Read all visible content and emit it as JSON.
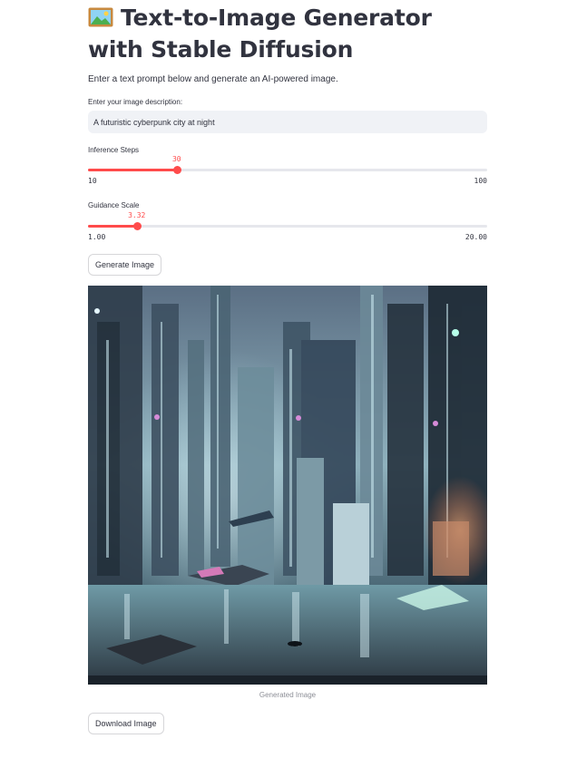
{
  "app": {
    "title_icon": "framed-picture-icon",
    "title": "Text-to-Image Generator with Stable Diffusion",
    "description": "Enter a text prompt below and generate an AI-powered image."
  },
  "prompt": {
    "label": "Enter your image description:",
    "value": "A futuristic cyberpunk city at night"
  },
  "sliders": {
    "inference_steps": {
      "label": "Inference Steps",
      "value": 30,
      "value_text": "30",
      "min": 10,
      "min_text": "10",
      "max": 100,
      "max_text": "100"
    },
    "guidance_scale": {
      "label": "Guidance Scale",
      "value": 3.32,
      "value_text": "3.32",
      "min": 1.0,
      "min_text": "1.00",
      "max": 20.0,
      "max_text": "20.00"
    }
  },
  "buttons": {
    "generate": "Generate Image",
    "download": "Download Image"
  },
  "image": {
    "caption": "Generated Image"
  },
  "colors": {
    "accent": "#ff4b4b",
    "text": "#31333f",
    "input_bg": "#f0f2f6"
  }
}
